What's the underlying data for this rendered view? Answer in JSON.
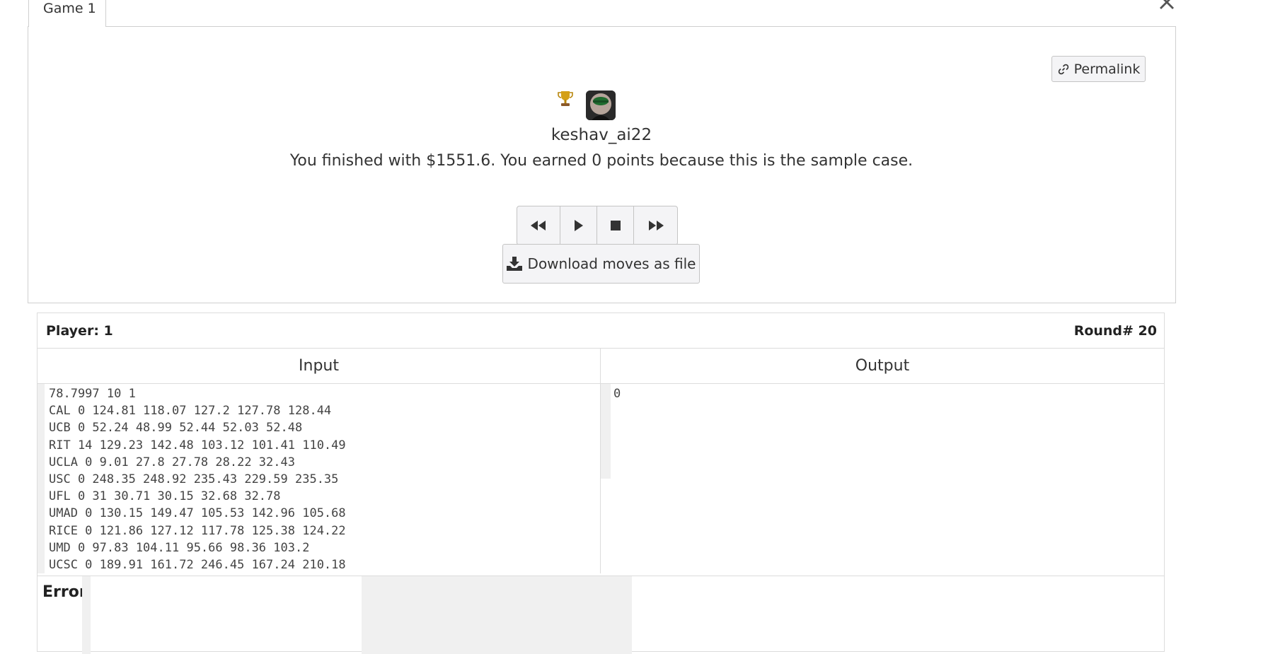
{
  "tabs": [
    {
      "label": "Game 1"
    }
  ],
  "toolbar": {
    "permalink_label": "Permalink"
  },
  "player_summary": {
    "username": "keshav_ai22",
    "message": "You finished with $1551.6. You earned 0 points because this is the sample case."
  },
  "playback": {
    "buttons": [
      "rewind-icon",
      "play-icon",
      "stop-icon",
      "fast-forward-icon"
    ],
    "download_label": "Download moves as file"
  },
  "card": {
    "player_label": "Player: 1",
    "round_label": "Round# 20",
    "input_header": "Input",
    "output_header": "Output",
    "input_text": "78.7997 10 1\nCAL 0 124.81 118.07 127.2 127.78 128.44\nUCB 0 52.24 48.99 52.44 52.03 52.48\nRIT 14 129.23 142.48 103.12 101.41 110.49\nUCLA 0 9.01 27.8 27.78 28.22 32.43\nUSC 0 248.35 248.92 235.43 229.59 235.35\nUFL 0 31 30.71 30.15 32.68 32.78\nUMAD 0 130.15 149.47 105.53 142.96 105.68\nRICE 0 121.86 127.12 117.78 125.38 124.22\nUMD 0 97.83 104.11 95.66 98.36 103.2\nUCSC 0 189.91 161.72 246.45 167.24 210.18",
    "output_text": "0",
    "error_label": "Error"
  },
  "colors": {
    "button_bg": "#f4f4f6",
    "border": "#cfcfcf",
    "icon": "#333333"
  }
}
